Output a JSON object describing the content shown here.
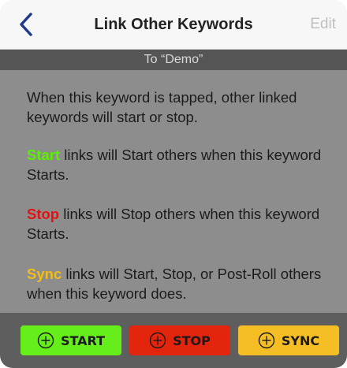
{
  "navbar": {
    "title": "Link Other Keywords",
    "edit_label": "Edit",
    "back_icon": "chevron-left-icon"
  },
  "subheader": {
    "text": "To “Demo”"
  },
  "content": {
    "intro": "When this keyword is tapped, other linked keywords will start or stop.",
    "start_keyword": "Start",
    "start_rest": " links will Start others when this keyword Starts.",
    "stop_keyword": "Stop",
    "stop_rest": " links will Stop others when this keyword Starts.",
    "sync_keyword": "Sync",
    "sync_rest": " links will Start, Stop, or Post-Roll others when this keyword does."
  },
  "toolbar": {
    "start_label": "START",
    "stop_label": "STOP",
    "sync_label": "SYNC",
    "add_icon": "plus-circle-icon"
  },
  "colors": {
    "start": "#66ee1a",
    "stop": "#e4250e",
    "sync": "#f6be25",
    "start_text": "#59f100",
    "stop_text": "#e8100f",
    "sync_text": "#f2bd18",
    "accent": "#1f3a8a"
  }
}
